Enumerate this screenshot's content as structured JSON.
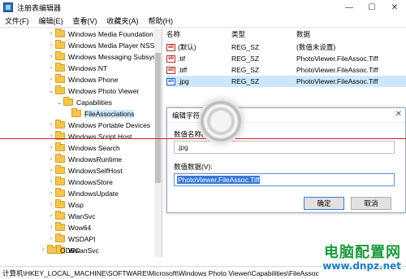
{
  "window": {
    "title": "注册表编辑器",
    "min_glyph": "—",
    "max_glyph": "☐",
    "close_glyph": "✕"
  },
  "menu": [
    "文件(F)",
    "编辑(E)",
    "查看(V)",
    "收藏夹(A)",
    "帮助(H)"
  ],
  "tree": {
    "items": [
      {
        "label": "Windows Media Foundation",
        "expanded": false
      },
      {
        "label": "Windows Media Player NSS",
        "expanded": false
      },
      {
        "label": "Windows Messaging Subsys",
        "expanded": false
      },
      {
        "label": "Windows NT",
        "expanded": false
      },
      {
        "label": "Windows Phone",
        "expanded": false
      },
      {
        "label": "Windows Photo Viewer",
        "expanded": true
      },
      {
        "label": "Capabilities",
        "expanded": true
      },
      {
        "label": "FileAssociations",
        "selected": true
      },
      {
        "label": "Windows Portable Devices",
        "expanded": false
      },
      {
        "label": "Windows Script Host",
        "expanded": false
      },
      {
        "label": "Windows Search",
        "expanded": false
      },
      {
        "label": "WindowsRuntime",
        "expanded": false
      },
      {
        "label": "WindowsSelfHost",
        "expanded": false
      },
      {
        "label": "WindowsStore",
        "expanded": false
      },
      {
        "label": "WindowsUpdate",
        "expanded": false
      },
      {
        "label": "Wisp",
        "expanded": false
      },
      {
        "label": "WlanSvc",
        "expanded": false
      },
      {
        "label": "Wow64",
        "expanded": false
      },
      {
        "label": "WSDAPI",
        "expanded": false
      },
      {
        "label": "WwanSvc",
        "expanded": false
      },
      {
        "label": "ODBC",
        "expanded": false
      }
    ]
  },
  "list": {
    "headers": {
      "name": "名称",
      "type": "类型",
      "data": "数据"
    },
    "rows": [
      {
        "icon": "ab",
        "name": "(默认)",
        "type": "REG_SZ",
        "data": "(数值未设置)"
      },
      {
        "icon": "ab",
        "name": ".tif",
        "type": "REG_SZ",
        "data": "PhotoViewer.FileAssoc.Tiff"
      },
      {
        "icon": "ab",
        "name": ".tiff",
        "type": "REG_SZ",
        "data": "PhotoViewer.FileAssoc.Tiff"
      },
      {
        "icon": "ab",
        "name": ".jpg",
        "type": "REG_SZ",
        "data": "PhotoViewer.FileAssoc.Tiff"
      }
    ]
  },
  "dialog": {
    "title": "编辑字符串",
    "close_glyph": "✕",
    "name_label": "数值名称(N):",
    "name_value": ".jpg",
    "data_label": "数值数据(V):",
    "data_value": "PhotoViewer.FileAssoc.Tiff",
    "ok_label": "确定",
    "cancel_label": "取消"
  },
  "status": {
    "path": "计算机\\HKEY_LOCAL_MACHINE\\SOFTWARE\\Microsoft\\Windows Photo Viewer\\Capabilities\\FileAssoc"
  },
  "watermark": {
    "cn": "电脑配置网",
    "url": "www.dnpz.net"
  },
  "colors": {
    "selection": "#cce8ff",
    "accent": "#3a78d6",
    "red_line": "#d0202a",
    "watermark_green": "#1c9a3c",
    "watermark_blue": "#1c7fc2"
  }
}
